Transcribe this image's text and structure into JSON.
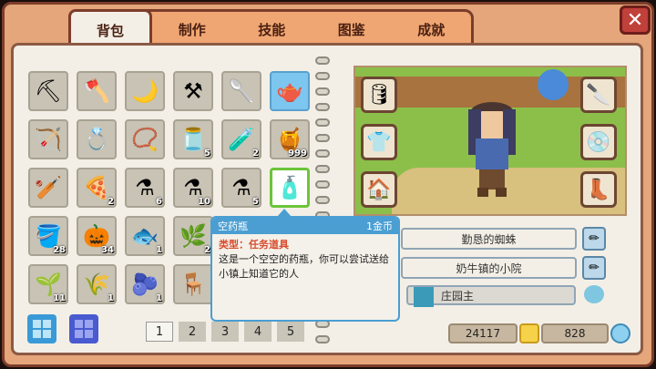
{
  "tabs": [
    "背包",
    "制作",
    "技能",
    "图鉴",
    "成就"
  ],
  "close_label": "✕",
  "inventory": [
    {
      "icon": "⛏",
      "count": ""
    },
    {
      "icon": "🪓",
      "count": ""
    },
    {
      "icon": "🌙",
      "count": ""
    },
    {
      "icon": "⚒",
      "count": ""
    },
    {
      "icon": "🥄",
      "count": ""
    },
    {
      "icon": "🫖",
      "count": ""
    },
    {
      "icon": "🏹",
      "count": ""
    },
    {
      "icon": "💍",
      "count": ""
    },
    {
      "icon": "📿",
      "count": ""
    },
    {
      "icon": "🫙",
      "count": "5"
    },
    {
      "icon": "🧪",
      "count": "2"
    },
    {
      "icon": "🍯",
      "count": "999"
    },
    {
      "icon": "🏏",
      "count": ""
    },
    {
      "icon": "🍕",
      "count": "2"
    },
    {
      "icon": "⚗",
      "count": "6"
    },
    {
      "icon": "⚗",
      "count": "10"
    },
    {
      "icon": "⚗",
      "count": "5"
    },
    {
      "icon": "🧴",
      "count": ""
    },
    {
      "icon": "🪣",
      "count": "28"
    },
    {
      "icon": "🎃",
      "count": "34"
    },
    {
      "icon": "🐟",
      "count": "1"
    },
    {
      "icon": "🌿",
      "count": "2"
    },
    {
      "icon": "🌱",
      "count": "11"
    },
    {
      "icon": "🌾",
      "count": "1"
    },
    {
      "icon": "🫐",
      "count": "1"
    },
    {
      "icon": "🪑",
      "count": ""
    }
  ],
  "tooltip": {
    "name": "空药瓶",
    "price": "1金币",
    "type": "类型：任务道具",
    "desc": "这是一个空空的药瓶，你可以尝试送给小镇上知道它的人"
  },
  "profile": {
    "title": "勤恳的蜘蛛",
    "farm": "奶牛镇的小院",
    "rank": "庄园主"
  },
  "pages": [
    "1",
    "2",
    "3",
    "4",
    "5"
  ],
  "currency": {
    "gold": "24117",
    "gems": "828"
  }
}
